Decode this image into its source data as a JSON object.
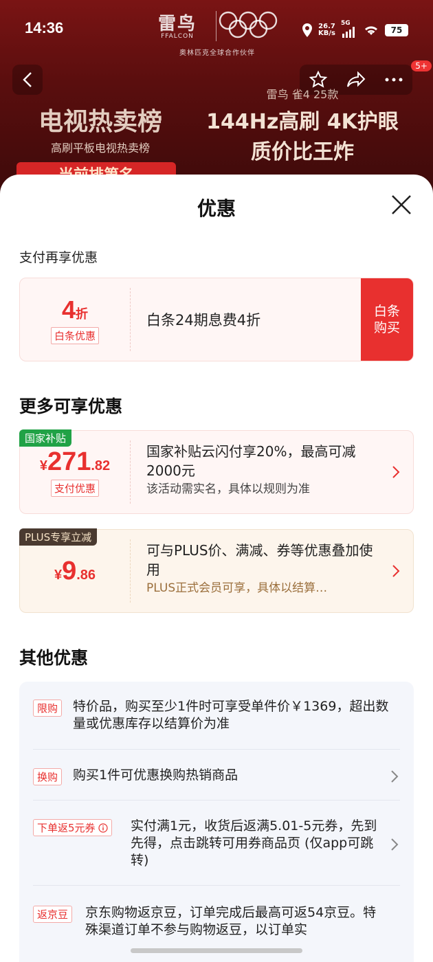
{
  "status_bar": {
    "time": "14:36",
    "net_speed_value": "26.7",
    "net_speed_unit": "KB/s",
    "network": "5G",
    "battery": "75"
  },
  "brand": {
    "logo": "雷鸟",
    "logo_sub": "FFALCON",
    "caption": "奥林匹克全球合作伙伴"
  },
  "top_nav": {
    "more_badge": "5+"
  },
  "banner": {
    "left_big": "电视热卖榜",
    "left_small": "高刷平板电视热卖榜",
    "model": "雷鸟 雀4 25款",
    "line1": "144Hz高刷 4K护眼",
    "line2": "质价比王炸",
    "tag": "当前排第名"
  },
  "sheet": {
    "title": "优惠",
    "pay_section_label": "支付再享优惠",
    "pay_card": {
      "value": "4",
      "unit": "折",
      "tag": "白条优惠",
      "desc": "白条24期息费4折",
      "button": "白条购买"
    },
    "more_section_heading": "更多可享优惠",
    "gov_card": {
      "corner_tag": "国家补贴",
      "currency": "¥",
      "int": "271",
      "dec": ".82",
      "tag": "支付优惠",
      "title": "国家补贴云闪付享20%，最高可减2000元",
      "sub": "该活动需实名，具体以规则为准"
    },
    "plus_card": {
      "corner_tag": "PLUS专享立减",
      "currency": "¥",
      "int": "9",
      "dec": ".86",
      "title": "可与PLUS价、满减、券等优惠叠加使用",
      "sub": "PLUS正式会员可享，具体以结算…"
    },
    "other_section_heading": "其他优惠",
    "other_offers": [
      {
        "tag": "限购",
        "text": "特价品，购买至少1件时可享受单件价￥1369，超出数量或优惠库存以结算价为准"
      },
      {
        "tag": "换购",
        "text": "购买1件可优惠换购热销商品"
      },
      {
        "tag": "下单返5元券",
        "text": "实付满1元，收货后返满5.01-5元券，先到先得，点击跳转可用券商品页 (仅app可跳转)"
      },
      {
        "tag": "返京豆",
        "text": "京东购物返京豆，订单完成后最高可返54京豆。特殊渠道订单不参与购物返豆，以订单实"
      }
    ]
  },
  "colors": {
    "accent_red": "#e8302f",
    "gov_green": "#21a246",
    "plus_dark": "#4a3a30"
  }
}
